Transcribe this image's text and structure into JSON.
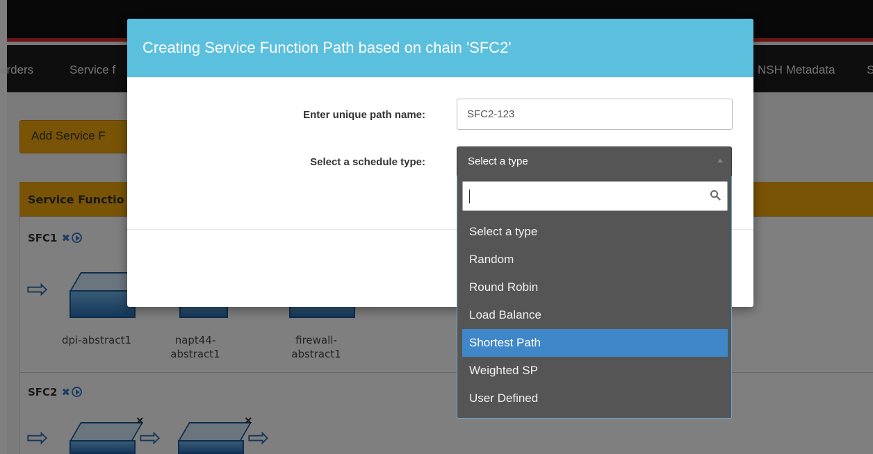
{
  "background": {
    "nav_items": [
      "arders",
      "Service f",
      "NSH Metadata",
      "S"
    ],
    "add_button_label": "Add Service F",
    "panel_title": "Service Functio",
    "chains": [
      {
        "name": "SFC1",
        "functions": [
          "dpi-abstract1",
          "napt44-\nabstract1",
          "firewall-\nabstract1"
        ]
      },
      {
        "name": "SFC2",
        "functions": []
      }
    ],
    "remove_glyph": "✖",
    "unlink_glyph": "×",
    "arrow_glyph": "⇨"
  },
  "modal": {
    "title": "Creating Service Function Path based on chain 'SFC2'",
    "path_name_label": "Enter unique path name:",
    "path_name_value": "SFC2-123",
    "schedule_label": "Select a schedule type:",
    "schedule_selected": "Select a type",
    "search_value": "",
    "options": [
      "Select a type",
      "Random",
      "Round Robin",
      "Load Balance",
      "Shortest Path",
      "Weighted SP",
      "User Defined"
    ],
    "highlighted_option": "Shortest Path"
  },
  "colors": {
    "header": "#5bc0de",
    "accent": "#f2a90c",
    "highlight": "#3f87c9",
    "dropdown_bg": "#555555"
  }
}
